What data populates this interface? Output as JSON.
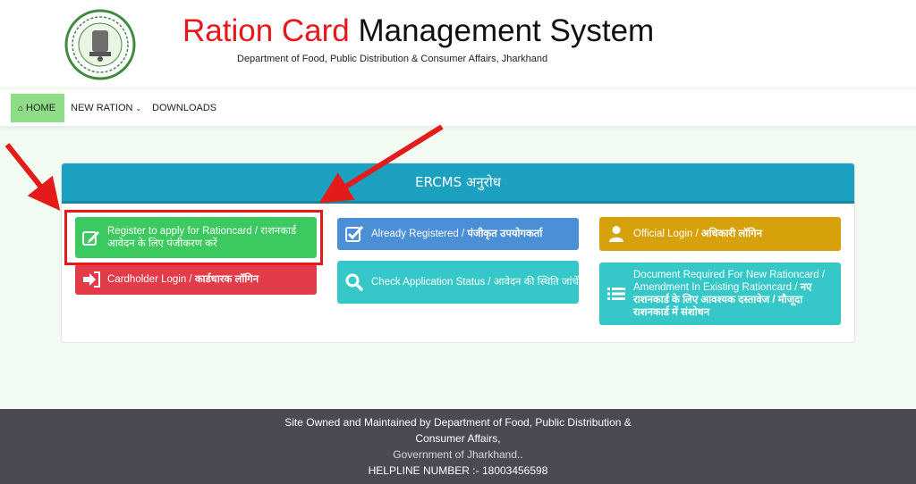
{
  "header": {
    "title_red": "Ration Card",
    "title_rest": " Management System",
    "subtitle": "Department of Food, Public Distribution & Consumer Affairs, Jharkhand"
  },
  "nav": {
    "home": "HOME",
    "new_ration": "NEW RATION",
    "downloads": "DOWNLOADS"
  },
  "panel": {
    "title": "ERCMS अनुरोध"
  },
  "buttons": {
    "register": "Register to apply for Rationcard / राशनकार्ड आवेदन के लिए पंजीकरण करें",
    "cardholder_en": "Cardholder Login / ",
    "cardholder_hi": "कार्डधारक लॉगिन",
    "already_en": "Already Registered / ",
    "already_hi": "पंजीकृत उपयोगकर्ता",
    "check": "Check Application Status / आवेदन की स्थिति जांचें",
    "official_en": "Official Login / ",
    "official_hi": "अधिकारी लॉगिन",
    "document_en": "Document Required For New Rationcard / Amendment In Existing Rationcard / ",
    "document_hi": "नए राशनकार्ड के लिए आवश्यक दस्तावेज / मौजूदा राशनकार्ड में संशोधन"
  },
  "footer": {
    "line1": "Site Owned and Maintained by Department of Food, Public Distribution & Consumer Affairs,",
    "line2": "Government of Jharkhand..",
    "helpline": "HELPLINE NUMBER :- 18003456598"
  },
  "colors": {
    "title_red": "#e8171a",
    "panel_header": "#1da1c0",
    "register": "#3cc95f",
    "cardholder": "#e23c4a",
    "already": "#4b8fd6",
    "check": "#36c8c8",
    "official": "#d6a10a",
    "annotation_red": "#e41b1b"
  },
  "icons": {
    "emblem": "jharkhand-emblem-icon",
    "home": "home-icon",
    "register": "edit-icon",
    "cardholder": "sign-in-icon",
    "already": "check-square-icon",
    "check": "search-icon",
    "official": "user-icon",
    "document": "list-icon"
  }
}
